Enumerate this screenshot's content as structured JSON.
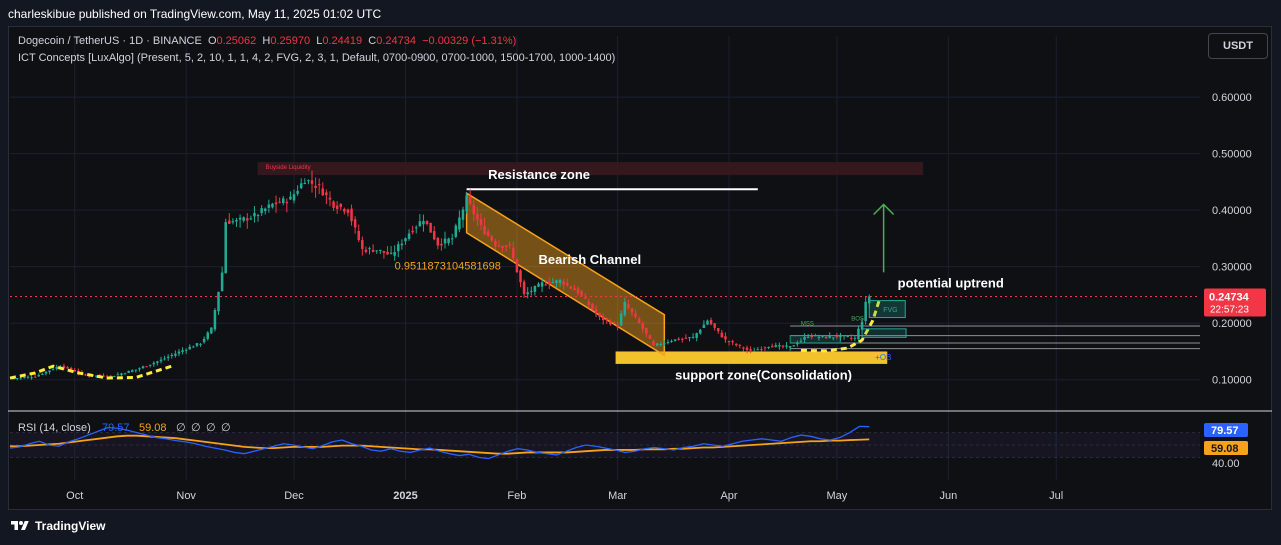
{
  "header": {
    "published": "charleskibue published on TradingView.com, May 11, 2025 01:02 UTC"
  },
  "legend": {
    "symbol": "Dogecoin / TetherUS · 1D · BINANCE",
    "o_label": "O",
    "o_value": "0.25062",
    "h_label": "H",
    "h_value": "0.25970",
    "l_label": "L",
    "l_value": "0.24419",
    "c_label": "C",
    "c_value": "0.24734",
    "change": "−0.00329 (−1.31%)",
    "indicator": "ICT Concepts [LuxAlgo] (Present, 5, 2, 10, 1, 1, 4, 2, FVG, 2, 3, 1, Default, 0700-0900, 0700-1000, 1500-1700, 1000-1400)"
  },
  "currency_button": "USDT",
  "footer": {
    "brand": "TradingView",
    "logo_icon": "tradingview-logo-icon"
  },
  "colors": {
    "background": "#0e1014",
    "up": "#22ab94",
    "down": "#f23645",
    "channel": "#f7a21b",
    "annotation_white": "#ffffff",
    "rsi_line": "#2962ff",
    "rsi_ma": "#f7a21b",
    "arrow": "#4caf50"
  },
  "annotations": {
    "resistance": "Resistance zone",
    "bearish": "Bearish Channel",
    "fib": "0.9511873104581698",
    "support": "support zone(Consolidation)",
    "uptrend": "potential  uptrend",
    "buyside": "Buyside Liquidity",
    "mss": "MSS",
    "bos": "BOS",
    "fvg": "FVG",
    "ob": "+OB"
  },
  "rsi": {
    "title": "RSI (14, close)",
    "value": "79.57",
    "ma_value": "59.08",
    "placeholders": [
      "∅",
      "∅",
      "∅",
      "∅"
    ],
    "scale_label": "40.00"
  },
  "price_tag": {
    "value": "0.24734",
    "countdown": "22:57:23"
  },
  "chart_data": {
    "type": "candlestick",
    "title": "Dogecoin / TetherUS · 1D · BINANCE",
    "y_ticks": [
      0.1,
      0.2,
      0.3,
      0.4,
      0.5,
      0.6
    ],
    "y_tick_labels": [
      "0.10000",
      "0.20000",
      "0.30000",
      "0.40000",
      "0.50000",
      "0.60000"
    ],
    "ylim": [
      0.05,
      0.655
    ],
    "x_tick_labels": [
      "Oct",
      "Nov",
      "Dec",
      "2025",
      "Feb",
      "Mar",
      "Apr",
      "May",
      "Jun",
      "Jul"
    ],
    "x_tick_dates": [
      "2024-10-01",
      "2024-11-01",
      "2024-12-01",
      "2025-01-01",
      "2025-02-01",
      "2025-03-01",
      "2025-04-01",
      "2025-05-01",
      "2025-06-01",
      "2025-07-01"
    ],
    "close_path": [
      {
        "date": "2024-09-13",
        "close": 0.102
      },
      {
        "date": "2024-09-20",
        "close": 0.106
      },
      {
        "date": "2024-09-27",
        "close": 0.125
      },
      {
        "date": "2024-10-04",
        "close": 0.108
      },
      {
        "date": "2024-10-11",
        "close": 0.106
      },
      {
        "date": "2024-10-18",
        "close": 0.118
      },
      {
        "date": "2024-10-25",
        "close": 0.135
      },
      {
        "date": "2024-11-01",
        "close": 0.155
      },
      {
        "date": "2024-11-05",
        "close": 0.165
      },
      {
        "date": "2024-11-08",
        "close": 0.19
      },
      {
        "date": "2024-11-11",
        "close": 0.29
      },
      {
        "date": "2024-11-12",
        "close": 0.38
      },
      {
        "date": "2024-11-15",
        "close": 0.38
      },
      {
        "date": "2024-11-20",
        "close": 0.39
      },
      {
        "date": "2024-11-25",
        "close": 0.41
      },
      {
        "date": "2024-11-30",
        "close": 0.42
      },
      {
        "date": "2024-12-04",
        "close": 0.455
      },
      {
        "date": "2024-12-08",
        "close": 0.44
      },
      {
        "date": "2024-12-12",
        "close": 0.41
      },
      {
        "date": "2024-12-16",
        "close": 0.4
      },
      {
        "date": "2024-12-20",
        "close": 0.33
      },
      {
        "date": "2024-12-24",
        "close": 0.33
      },
      {
        "date": "2024-12-28",
        "close": 0.32
      },
      {
        "date": "2025-01-02",
        "close": 0.36
      },
      {
        "date": "2025-01-06",
        "close": 0.385
      },
      {
        "date": "2025-01-10",
        "close": 0.34
      },
      {
        "date": "2025-01-14",
        "close": 0.35
      },
      {
        "date": "2025-01-18",
        "close": 0.42
      },
      {
        "date": "2025-01-22",
        "close": 0.37
      },
      {
        "date": "2025-01-26",
        "close": 0.34
      },
      {
        "date": "2025-01-30",
        "close": 0.335
      },
      {
        "date": "2025-02-03",
        "close": 0.25
      },
      {
        "date": "2025-02-08",
        "close": 0.27
      },
      {
        "date": "2025-02-13",
        "close": 0.275
      },
      {
        "date": "2025-02-18",
        "close": 0.255
      },
      {
        "date": "2025-02-24",
        "close": 0.21
      },
      {
        "date": "2025-03-01",
        "close": 0.195
      },
      {
        "date": "2025-03-03",
        "close": 0.235
      },
      {
        "date": "2025-03-07",
        "close": 0.2
      },
      {
        "date": "2025-03-11",
        "close": 0.16
      },
      {
        "date": "2025-03-16",
        "close": 0.17
      },
      {
        "date": "2025-03-22",
        "close": 0.175
      },
      {
        "date": "2025-03-26",
        "close": 0.205
      },
      {
        "date": "2025-03-31",
        "close": 0.17
      },
      {
        "date": "2025-04-07",
        "close": 0.15
      },
      {
        "date": "2025-04-12",
        "close": 0.16
      },
      {
        "date": "2025-04-18",
        "close": 0.158
      },
      {
        "date": "2025-04-23",
        "close": 0.178
      },
      {
        "date": "2025-04-28",
        "close": 0.175
      },
      {
        "date": "2025-05-02",
        "close": 0.177
      },
      {
        "date": "2025-05-06",
        "close": 0.173
      },
      {
        "date": "2025-05-08",
        "close": 0.205
      },
      {
        "date": "2025-05-09",
        "close": 0.235
      },
      {
        "date": "2025-05-10",
        "close": 0.248
      }
    ],
    "zones": [
      {
        "name": "resistance",
        "start": "2024-12-02",
        "end": "2025-05-25",
        "low": 0.462,
        "high": 0.485
      },
      {
        "name": "support",
        "start": "2025-03-01",
        "end": "2025-05-10",
        "low": 0.128,
        "high": 0.15
      }
    ],
    "channel": {
      "upper": [
        {
          "date": "2025-01-18",
          "value": 0.43
        },
        {
          "date": "2025-03-14",
          "value": 0.215
        }
      ],
      "lower": [
        {
          "date": "2025-01-18",
          "value": 0.36
        },
        {
          "date": "2025-03-14",
          "value": 0.143
        }
      ]
    },
    "resistance_line": {
      "start": "2025-01-18",
      "end": "2025-04-09",
      "value": 0.437
    },
    "projection_arrow": {
      "date": "2025-05-14",
      "from": 0.29,
      "to": 0.41
    },
    "last_price": 0.24734,
    "rsi": {
      "ylim": [
        0,
        100
      ],
      "ticks": [
        40
      ],
      "series": [
        {
          "name": "RSI",
          "values": [
            45,
            47,
            52,
            56,
            50,
            48,
            55,
            60,
            66,
            72,
            78,
            77,
            74,
            70,
            66,
            62,
            60,
            57,
            55,
            52,
            48,
            45,
            42,
            38,
            36,
            40,
            44,
            48,
            52,
            50,
            47,
            44,
            49,
            55,
            58,
            52,
            48,
            42,
            40,
            44,
            40,
            38,
            42,
            45,
            40,
            36,
            33,
            35,
            30,
            28,
            34,
            40,
            44,
            42,
            38,
            36,
            34,
            40,
            46,
            50,
            48,
            45,
            42,
            38,
            40,
            44,
            46,
            44,
            42,
            46,
            48,
            52,
            50,
            48,
            52,
            56,
            58,
            60,
            58,
            56,
            62,
            66,
            64,
            60,
            58,
            62,
            70,
            80,
            79.57
          ]
        },
        {
          "name": "MA",
          "values": [
            48,
            48,
            49,
            50,
            51,
            52,
            54,
            56,
            58,
            60,
            62,
            64,
            65,
            65,
            64,
            63,
            62,
            61,
            59,
            57,
            55,
            53,
            51,
            49,
            47,
            46,
            45,
            45,
            46,
            47,
            47,
            47,
            47,
            48,
            49,
            49,
            49,
            48,
            47,
            46,
            45,
            44,
            43,
            43,
            42,
            41,
            40,
            39,
            38,
            37,
            36,
            36,
            37,
            38,
            38,
            38,
            38,
            38,
            39,
            40,
            41,
            42,
            42,
            42,
            42,
            43,
            43,
            43,
            44,
            44,
            45,
            46,
            46,
            47,
            48,
            49,
            50,
            51,
            52,
            53,
            54,
            55,
            56,
            56,
            57,
            57,
            58,
            58.5,
            59.08
          ]
        }
      ]
    }
  }
}
